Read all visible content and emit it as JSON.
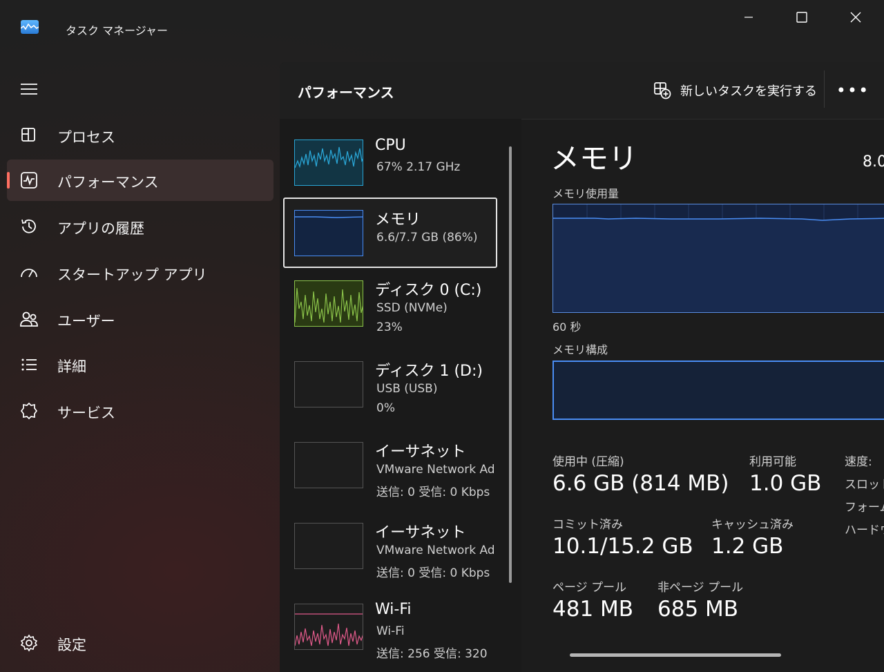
{
  "window": {
    "title": "タスク マネージャー"
  },
  "sidebar": {
    "items": [
      {
        "label": "プロセス",
        "icon": "processes-icon"
      },
      {
        "label": "パフォーマンス",
        "icon": "performance-icon",
        "active": true
      },
      {
        "label": "アプリの履歴",
        "icon": "history-icon"
      },
      {
        "label": "スタートアップ アプリ",
        "icon": "startup-icon"
      },
      {
        "label": "ユーザー",
        "icon": "users-icon"
      },
      {
        "label": "詳細",
        "icon": "details-icon"
      },
      {
        "label": "サービス",
        "icon": "services-icon"
      }
    ],
    "settings_label": "設定"
  },
  "header": {
    "title": "パフォーマンス",
    "new_task_label": "新しいタスクを実行する",
    "more_label": "•••"
  },
  "perf_list": [
    {
      "name": "CPU",
      "sub": "67%  2.17 GHz",
      "sub2": ""
    },
    {
      "name": "メモリ",
      "sub": "6.6/7.7 GB (86%)",
      "sub2": "",
      "selected": true
    },
    {
      "name": "ディスク 0 (C:)",
      "sub": "SSD (NVMe)",
      "sub2": "23%"
    },
    {
      "name": "ディスク 1 (D:)",
      "sub": "USB (USB)",
      "sub2": "0%"
    },
    {
      "name": "イーサネット",
      "sub": "VMware Network Ad",
      "sub2": "送信: 0  受信: 0 Kbps"
    },
    {
      "name": "イーサネット",
      "sub": "VMware Network Ad",
      "sub2": "送信: 0  受信: 0 Kbps"
    },
    {
      "name": "Wi-Fi",
      "sub": "Wi-Fi",
      "sub2": "送信: 256  受信: 320"
    }
  ],
  "detail": {
    "title": "メモリ",
    "total": "8.0",
    "usage_label": "メモリ使用量",
    "time_label": "60 秒",
    "composition_label": "メモリ構成",
    "stats": {
      "in_use_label": "使用中 (圧縮)",
      "in_use_value": "6.6 GB (814 MB)",
      "available_label": "利用可能",
      "available_value": "1.0 GB",
      "committed_label": "コミット済み",
      "committed_value": "10.1/15.2 GB",
      "cached_label": "キャッシュ済み",
      "cached_value": "1.2 GB",
      "paged_label": "ページ プール",
      "paged_value": "481 MB",
      "nonpaged_label": "非ページ プール",
      "nonpaged_value": "685 MB"
    },
    "side": {
      "speed_label": "速度:",
      "slots_label": "スロット",
      "form_label": "フォーム",
      "hardware_label": "ハードウ"
    }
  },
  "colors": {
    "accent": "#ff6f61",
    "cpu": "#2aa6d6",
    "memory": "#4a8ef5",
    "disk": "#8bc34a",
    "wifi": "#e05a8a"
  }
}
